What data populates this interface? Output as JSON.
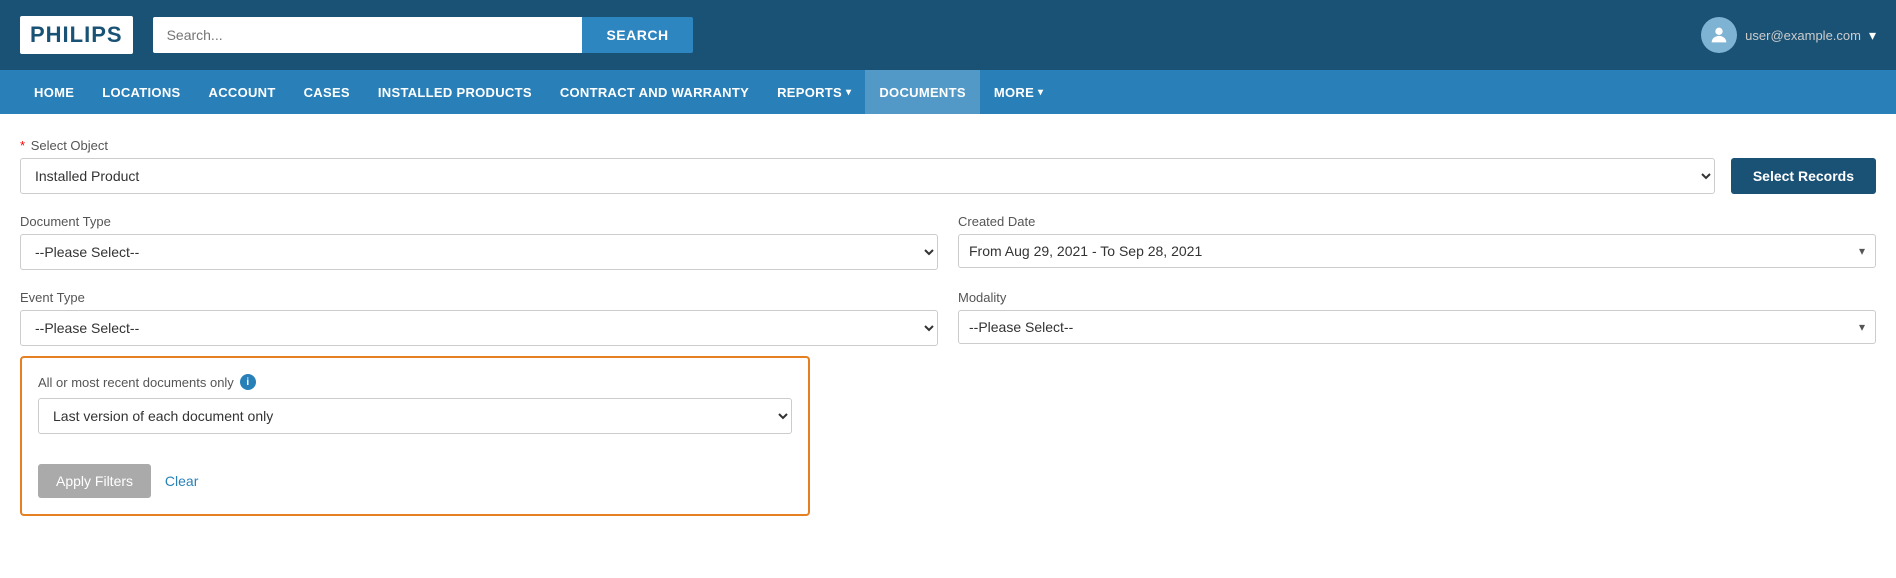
{
  "header": {
    "logo": "PHILIPS",
    "search_placeholder": "Search...",
    "search_button_label": "SEARCH",
    "user_name": "user@example.com",
    "user_icon": "👤"
  },
  "nav": {
    "items": [
      {
        "label": "HOME",
        "active": false
      },
      {
        "label": "LOCATIONS",
        "active": false
      },
      {
        "label": "ACCOUNT",
        "active": false
      },
      {
        "label": "CASES",
        "active": false
      },
      {
        "label": "INSTALLED PRODUCTS",
        "active": false
      },
      {
        "label": "CONTRACT AND WARRANTY",
        "active": false
      },
      {
        "label": "REPORTS",
        "active": false,
        "hasChevron": true
      },
      {
        "label": "DOCUMENTS",
        "active": true
      },
      {
        "label": "MORE",
        "active": false,
        "hasChevron": true
      }
    ]
  },
  "form": {
    "select_object_label": "Select Object",
    "select_object_required": "*",
    "select_object_value": "Installed Product",
    "select_records_button": "Select Records",
    "document_type_label": "Document Type",
    "document_type_placeholder": "--Please Select--",
    "event_type_label": "Event Type",
    "event_type_placeholder": "--Please Select--",
    "created_date_label": "Created Date",
    "created_date_value": "From Aug 29, 2021 - To Sep 28, 2021",
    "modality_label": "Modality",
    "modality_placeholder": "--Please Select--",
    "recent_docs_label": "All or most recent documents only",
    "recent_docs_value": "Last version of each document only",
    "apply_filters_label": "Apply Filters",
    "clear_label": "Clear"
  }
}
